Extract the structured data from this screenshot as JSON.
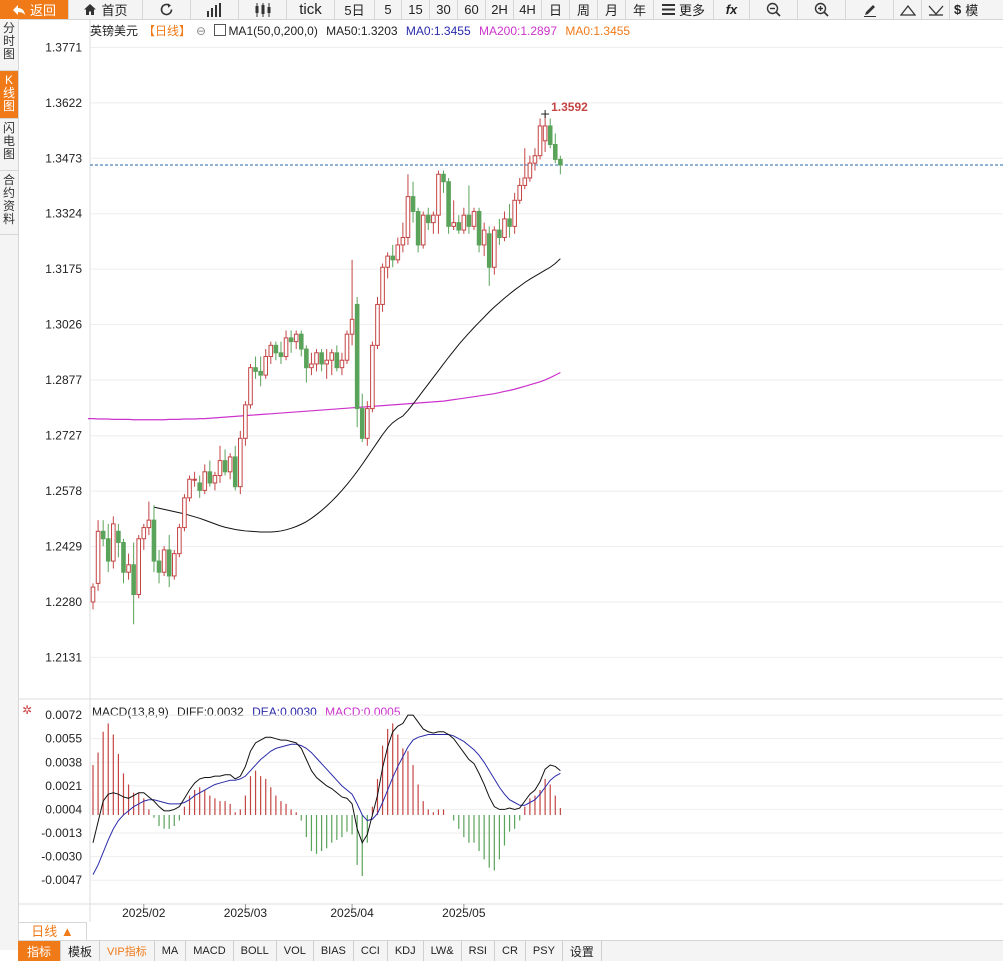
{
  "toolbar": {
    "back": "返回",
    "home": "首页",
    "tick": "tick",
    "periods": [
      "5日",
      "5",
      "15",
      "30",
      "60",
      "2H",
      "4H",
      "日",
      "周",
      "月",
      "年"
    ],
    "more": "更多",
    "fx": "fx",
    "tail": "模"
  },
  "left_tabs": [
    "分时图",
    "K线图",
    "闪电图",
    "合约资料"
  ],
  "legend": {
    "symbol": "英镑美元",
    "period": "【日线】",
    "ma_label": "MA1(50,0,200,0)",
    "ma50": "MA50:1.3203",
    "ma0": "MA0:1.3455",
    "ma200": "MA200:1.2897",
    "ma0b": "MA0:1.3455"
  },
  "macd_legend": {
    "label": "MACD(13,8,9)",
    "diff": "DIFF:0.0032",
    "dea": "DEA:0.0030",
    "macd": "MACD:0.0005"
  },
  "bottom": {
    "period_tab": "日线 ▲",
    "indicators": [
      "指标",
      "模板",
      "VIP指标",
      "MA",
      "MACD",
      "BOLL",
      "VOL",
      "BIAS",
      "CCI",
      "KDJ",
      "LW&",
      "RSI",
      "CR",
      "PSY",
      "设置"
    ]
  },
  "colors": {
    "up": "#c44444",
    "down": "#5aa35a",
    "ma50": "#111111",
    "ma200": "#cc33cc",
    "dea": "#2a2aaa",
    "accent": "#f07a18",
    "price_line": "#2266aa"
  },
  "chart_data": [
    {
      "type": "candlestick",
      "title": "英镑美元 日线",
      "y_ticks": [
        1.3771,
        1.3622,
        1.3473,
        1.3324,
        1.3175,
        1.3026,
        1.2877,
        1.2727,
        1.2578,
        1.2429,
        1.228,
        1.2131
      ],
      "x_labels": [
        {
          "label": "2025/02",
          "index": 10
        },
        {
          "label": "2025/03",
          "index": 30
        },
        {
          "label": "2025/04",
          "index": 51
        },
        {
          "label": "2025/05",
          "index": 73
        }
      ],
      "ylim": [
        1.2046,
        1.3826
      ],
      "last_price": 1.3455,
      "high_annotation": {
        "label": "1.3592",
        "value": 1.3592,
        "index": 89
      },
      "ohlc": [
        [
          1.228,
          1.233,
          1.226,
          1.232
        ],
        [
          1.233,
          1.25,
          1.231,
          1.247
        ],
        [
          1.247,
          1.25,
          1.243,
          1.245
        ],
        [
          1.245,
          1.249,
          1.236,
          1.239
        ],
        [
          1.239,
          1.251,
          1.237,
          1.249
        ],
        [
          1.247,
          1.249,
          1.24,
          1.244
        ],
        [
          1.244,
          1.245,
          1.233,
          1.236
        ],
        [
          1.236,
          1.241,
          1.234,
          1.238
        ],
        [
          1.238,
          1.244,
          1.222,
          1.23
        ],
        [
          1.23,
          1.246,
          1.229,
          1.245
        ],
        [
          1.245,
          1.249,
          1.242,
          1.248
        ],
        [
          1.248,
          1.255,
          1.246,
          1.25
        ],
        [
          1.25,
          1.254,
          1.236,
          1.239
        ],
        [
          1.239,
          1.242,
          1.233,
          1.236
        ],
        [
          1.236,
          1.243,
          1.235,
          1.242
        ],
        [
          1.242,
          1.246,
          1.232,
          1.235
        ],
        [
          1.235,
          1.242,
          1.234,
          1.241
        ],
        [
          1.241,
          1.249,
          1.24,
          1.248
        ],
        [
          1.248,
          1.257,
          1.247,
          1.256
        ],
        [
          1.256,
          1.262,
          1.255,
          1.261
        ],
        [
          1.261,
          1.263,
          1.259,
          1.261
        ],
        [
          1.26,
          1.262,
          1.256,
          1.258
        ],
        [
          1.258,
          1.265,
          1.257,
          1.263
        ],
        [
          1.263,
          1.266,
          1.259,
          1.26
        ],
        [
          1.26,
          1.263,
          1.258,
          1.262
        ],
        [
          1.262,
          1.27,
          1.26,
          1.266
        ],
        [
          1.266,
          1.269,
          1.262,
          1.263
        ],
        [
          1.263,
          1.268,
          1.261,
          1.267
        ],
        [
          1.267,
          1.27,
          1.258,
          1.259
        ],
        [
          1.259,
          1.274,
          1.257,
          1.272
        ],
        [
          1.272,
          1.282,
          1.27,
          1.281
        ],
        [
          1.281,
          1.292,
          1.28,
          1.291
        ],
        [
          1.291,
          1.294,
          1.288,
          1.29
        ],
        [
          1.29,
          1.294,
          1.286,
          1.289
        ],
        [
          1.289,
          1.296,
          1.288,
          1.294
        ],
        [
          1.294,
          1.298,
          1.292,
          1.297
        ],
        [
          1.297,
          1.298,
          1.293,
          1.295
        ],
        [
          1.295,
          1.298,
          1.292,
          1.294
        ],
        [
          1.294,
          1.301,
          1.293,
          1.299
        ],
        [
          1.299,
          1.301,
          1.295,
          1.298
        ],
        [
          1.298,
          1.301,
          1.296,
          1.3
        ],
        [
          1.3,
          1.301,
          1.294,
          1.296
        ],
        [
          1.296,
          1.297,
          1.287,
          1.291
        ],
        [
          1.291,
          1.295,
          1.289,
          1.292
        ],
        [
          1.292,
          1.296,
          1.29,
          1.295
        ],
        [
          1.295,
          1.296,
          1.29,
          1.292
        ],
        [
          1.292,
          1.296,
          1.288,
          1.293
        ],
        [
          1.293,
          1.296,
          1.289,
          1.295
        ],
        [
          1.295,
          1.297,
          1.29,
          1.291
        ],
        [
          1.291,
          1.295,
          1.289,
          1.293
        ],
        [
          1.293,
          1.301,
          1.292,
          1.3
        ],
        [
          1.3,
          1.32,
          1.297,
          1.304
        ],
        [
          1.308,
          1.31,
          1.275,
          1.28
        ],
        [
          1.28,
          1.284,
          1.271,
          1.272
        ],
        [
          1.272,
          1.282,
          1.27,
          1.28
        ],
        [
          1.28,
          1.298,
          1.279,
          1.297
        ],
        [
          1.297,
          1.31,
          1.296,
          1.308
        ],
        [
          1.308,
          1.319,
          1.306,
          1.318
        ],
        [
          1.318,
          1.322,
          1.315,
          1.321
        ],
        [
          1.321,
          1.324,
          1.318,
          1.32
        ],
        [
          1.32,
          1.326,
          1.319,
          1.324
        ],
        [
          1.324,
          1.33,
          1.322,
          1.326
        ],
        [
          1.326,
          1.343,
          1.324,
          1.337
        ],
        [
          1.337,
          1.341,
          1.33,
          1.333
        ],
        [
          1.333,
          1.334,
          1.322,
          1.324
        ],
        [
          1.324,
          1.333,
          1.323,
          1.332
        ],
        [
          1.332,
          1.334,
          1.328,
          1.33
        ],
        [
          1.33,
          1.333,
          1.327,
          1.332
        ],
        [
          1.332,
          1.344,
          1.327,
          1.343
        ],
        [
          1.343,
          1.344,
          1.338,
          1.341
        ],
        [
          1.341,
          1.342,
          1.327,
          1.329
        ],
        [
          1.329,
          1.336,
          1.328,
          1.33
        ],
        [
          1.33,
          1.332,
          1.327,
          1.328
        ],
        [
          1.328,
          1.334,
          1.327,
          1.332
        ],
        [
          1.332,
          1.34,
          1.327,
          1.329
        ],
        [
          1.329,
          1.334,
          1.328,
          1.333
        ],
        [
          1.333,
          1.334,
          1.322,
          1.324
        ],
        [
          1.324,
          1.33,
          1.321,
          1.328
        ],
        [
          1.327,
          1.329,
          1.313,
          1.318
        ],
        [
          1.318,
          1.329,
          1.316,
          1.328
        ],
        [
          1.328,
          1.331,
          1.324,
          1.326
        ],
        [
          1.326,
          1.333,
          1.325,
          1.331
        ],
        [
          1.331,
          1.335,
          1.326,
          1.329
        ],
        [
          1.329,
          1.338,
          1.327,
          1.336
        ],
        [
          1.336,
          1.342,
          1.335,
          1.34
        ],
        [
          1.34,
          1.35,
          1.339,
          1.342
        ],
        [
          1.342,
          1.348,
          1.341,
          1.346
        ],
        [
          1.346,
          1.35,
          1.344,
          1.348
        ],
        [
          1.348,
          1.358,
          1.347,
          1.356
        ],
        [
          1.352,
          1.359,
          1.349,
          1.356
        ],
        [
          1.356,
          1.358,
          1.35,
          1.351
        ],
        [
          1.351,
          1.354,
          1.346,
          1.347
        ],
        [
          1.347,
          1.348,
          1.343,
          1.3455
        ]
      ],
      "ma50": [
        1.2535,
        1.2532,
        1.2529,
        1.2526,
        1.2523,
        1.252,
        1.2517,
        1.2513,
        1.2509,
        1.2505,
        1.25,
        1.2495,
        1.249,
        1.2485,
        1.2481,
        1.2478,
        1.2475,
        1.2473,
        1.2471,
        1.247,
        1.2469,
        1.2468,
        1.2468,
        1.2468,
        1.2469,
        1.2471,
        1.2474,
        1.2478,
        1.2483,
        1.2489,
        1.2496,
        1.2505,
        1.2515,
        1.2526,
        1.2538,
        1.2551,
        1.2565,
        1.258,
        1.2596,
        1.2613,
        1.2631,
        1.265,
        1.267,
        1.269,
        1.271,
        1.273,
        1.2748,
        1.2762,
        1.2772,
        1.278,
        1.2795,
        1.2812,
        1.283,
        1.2848,
        1.2866,
        1.2884,
        1.2902,
        1.292,
        1.2938,
        1.2955,
        1.2972,
        1.2988,
        1.3003,
        1.3018,
        1.3032,
        1.3046,
        1.306,
        1.3073,
        1.3085,
        1.3097,
        1.3108,
        1.3119,
        1.3129,
        1.3139,
        1.3148,
        1.3156,
        1.3164,
        1.3172,
        1.318,
        1.319,
        1.3203
      ],
      "ma200": [
        1.2773,
        1.2773,
        1.2772,
        1.2772,
        1.2772,
        1.2771,
        1.2771,
        1.2771,
        1.2771,
        1.277,
        1.277,
        1.277,
        1.277,
        1.277,
        1.277,
        1.277,
        1.2771,
        1.2771,
        1.2771,
        1.2772,
        1.2772,
        1.2772,
        1.2773,
        1.2773,
        1.2774,
        1.2775,
        1.2776,
        1.2777,
        1.2778,
        1.2779,
        1.278,
        1.2781,
        1.2782,
        1.2783,
        1.2784,
        1.2785,
        1.2786,
        1.2787,
        1.2788,
        1.2789,
        1.279,
        1.2791,
        1.2792,
        1.2793,
        1.2794,
        1.2795,
        1.2796,
        1.2797,
        1.2798,
        1.2799,
        1.28,
        1.2801,
        1.2802,
        1.2803,
        1.2804,
        1.2805,
        1.2806,
        1.2807,
        1.2808,
        1.2809,
        1.281,
        1.2811,
        1.2812,
        1.2813,
        1.2814,
        1.2815,
        1.2816,
        1.2817,
        1.2818,
        1.2819,
        1.282,
        1.2822,
        1.2824,
        1.2826,
        1.2828,
        1.283,
        1.2832,
        1.2834,
        1.2836,
        1.2838,
        1.284,
        1.2843,
        1.2846,
        1.2849,
        1.2852,
        1.2856,
        1.286,
        1.2864,
        1.2868,
        1.2872,
        1.2877,
        1.2883,
        1.289,
        1.2897
      ]
    },
    {
      "type": "macd",
      "title": "MACD(13,8,9)",
      "y_ticks": [
        0.0072,
        0.0055,
        0.0038,
        0.0021,
        0.0004,
        -0.0013,
        -0.003,
        -0.0047
      ],
      "ylim": [
        -0.0062,
        0.008
      ],
      "diff": [
        -0.002,
        -0.0005,
        0.001,
        0.0015,
        0.0016,
        0.0015,
        0.0013,
        0.0012,
        0.0014,
        0.0016,
        0.0016,
        0.0013,
        0.001,
        0.0006,
        0.0003,
        0.0003,
        0.0004,
        0.0006,
        0.0012,
        0.0018,
        0.0023,
        0.0026,
        0.0027,
        0.0027,
        0.0028,
        0.0028,
        0.0029,
        0.0029,
        0.0026,
        0.0028,
        0.0035,
        0.0046,
        0.0052,
        0.0054,
        0.0056,
        0.0056,
        0.0055,
        0.0054,
        0.0054,
        0.0053,
        0.0052,
        0.0048,
        0.004,
        0.0032,
        0.0027,
        0.0024,
        0.0021,
        0.0019,
        0.0016,
        0.0013,
        0.0012,
        0.0008,
        -0.001,
        -0.002,
        -0.0014,
        0.0,
        0.0014,
        0.0034,
        0.0049,
        0.006,
        0.0064,
        0.0066,
        0.0072,
        0.0072,
        0.0067,
        0.0062,
        0.006,
        0.0059,
        0.006,
        0.006,
        0.0058,
        0.0055,
        0.005,
        0.0045,
        0.004,
        0.0037,
        0.003,
        0.0022,
        0.0013,
        0.0006,
        0.0004,
        0.0004,
        0.0005,
        0.0004,
        0.0005,
        0.001,
        0.0015,
        0.0018,
        0.0024,
        0.0033,
        0.0036,
        0.0035,
        0.0032
      ],
      "dea": [
        -0.0043,
        -0.0036,
        -0.0027,
        -0.0018,
        -0.001,
        -0.0004,
        0.0,
        0.0003,
        0.0006,
        0.0008,
        0.001,
        0.0011,
        0.0011,
        0.001,
        0.0009,
        0.0008,
        0.0008,
        0.0008,
        0.0009,
        0.0011,
        0.0014,
        0.0016,
        0.0018,
        0.002,
        0.0022,
        0.0023,
        0.0024,
        0.0025,
        0.0025,
        0.0026,
        0.0028,
        0.0032,
        0.0036,
        0.004,
        0.0043,
        0.0046,
        0.0048,
        0.0049,
        0.005,
        0.0051,
        0.0051,
        0.005,
        0.0048,
        0.0045,
        0.0041,
        0.0037,
        0.0033,
        0.0029,
        0.0025,
        0.0021,
        0.0018,
        0.0015,
        0.0008,
        0.0,
        -0.0004,
        -0.0003,
        0.0001,
        0.0009,
        0.0018,
        0.0027,
        0.0035,
        0.0042,
        0.0049,
        0.0054,
        0.0056,
        0.0057,
        0.0058,
        0.0058,
        0.0058,
        0.0058,
        0.0058,
        0.0057,
        0.0055,
        0.0053,
        0.005,
        0.0047,
        0.0043,
        0.0038,
        0.0032,
        0.0026,
        0.002,
        0.0015,
        0.0011,
        0.0009,
        0.0007,
        0.0007,
        0.0009,
        0.0011,
        0.0015,
        0.002,
        0.0025,
        0.0028,
        0.003
      ],
      "histogram": [
        0.0036,
        0.0045,
        0.006,
        0.0066,
        0.0058,
        0.0044,
        0.003,
        0.0022,
        0.0016,
        0.0016,
        0.0012,
        0.0004,
        -0.0002,
        -0.0008,
        -0.001,
        -0.001,
        -0.0008,
        -0.0004,
        0.0006,
        0.0014,
        0.0018,
        0.002,
        0.0018,
        0.0014,
        0.0012,
        0.001,
        0.001,
        0.0008,
        0.0002,
        0.0004,
        0.0014,
        0.0028,
        0.0032,
        0.0028,
        0.0026,
        0.002,
        0.0014,
        0.001,
        0.0008,
        0.0004,
        0.0002,
        -0.0004,
        -0.0016,
        -0.0026,
        -0.0028,
        -0.0026,
        -0.0024,
        -0.002,
        -0.0018,
        -0.0016,
        -0.0012,
        -0.0014,
        -0.0036,
        -0.0044,
        -0.002,
        0.0006,
        0.0026,
        0.005,
        0.0062,
        0.0066,
        0.0058,
        0.0048,
        0.0046,
        0.0036,
        0.0022,
        0.001,
        0.0004,
        0.0002,
        0.0004,
        0.0004,
        0.0,
        -0.0004,
        -0.001,
        -0.0016,
        -0.002,
        -0.002,
        -0.0026,
        -0.0032,
        -0.0038,
        -0.004,
        -0.0032,
        -0.0022,
        -0.0012,
        -0.001,
        -0.0004,
        0.0006,
        0.0012,
        0.0014,
        0.0018,
        0.0026,
        0.0022,
        0.0014,
        0.0005
      ]
    }
  ]
}
